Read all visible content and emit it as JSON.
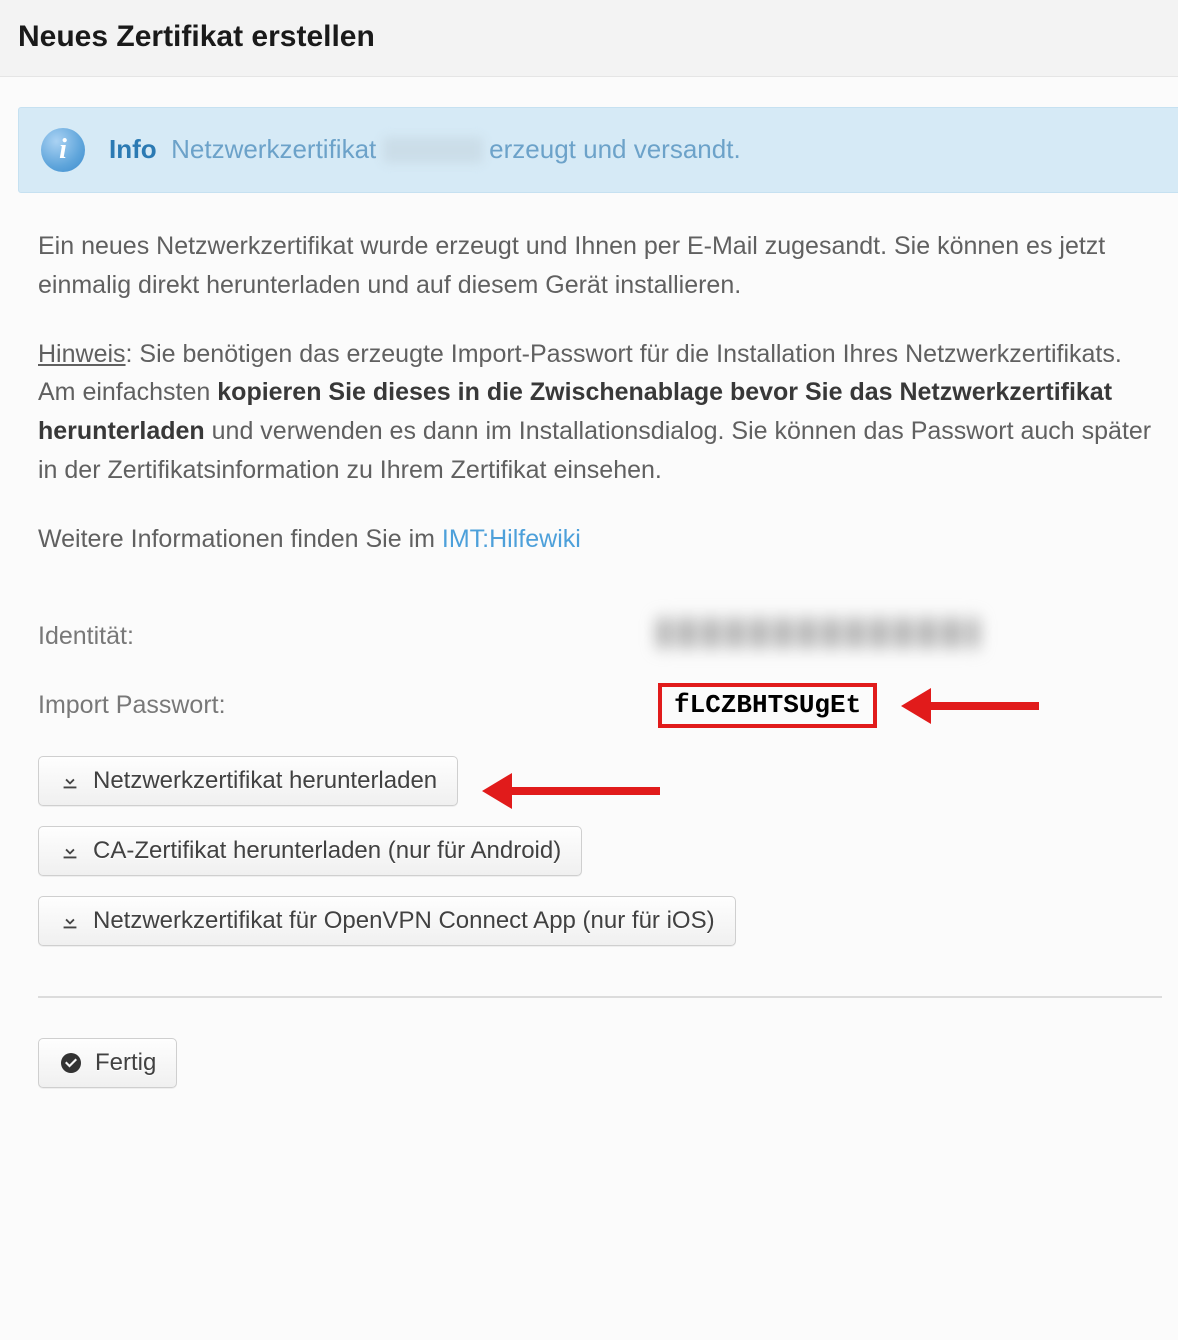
{
  "header": {
    "title": "Neues Zertifikat erstellen"
  },
  "info": {
    "label": "Info",
    "text_before": "Netzwerkzertifikat",
    "text_after": "erzeugt und versandt."
  },
  "paragraphs": {
    "p1": "Ein neues Netzwerkzertifikat wurde erzeugt und Ihnen per E-Mail zugesandt. Sie können es jetzt einmalig direkt herunterladen und auf diesem Gerät installieren.",
    "p2_label": "Hinweis",
    "p2_a": ": Sie benötigen das erzeugte Import-Passwort für die Installation Ihres Netzwerkzertifikats. Am einfachsten ",
    "p2_bold": "kopieren Sie dieses in die Zwischenablage bevor Sie das Netzwerkzertifikat herunterladen",
    "p2_b": " und verwenden es dann im Installationsdialog. Sie können das Passwort auch später in der Zertifikatsinformation zu Ihrem Zertifikat einsehen.",
    "p3_a": "Weitere Informationen finden Sie im ",
    "p3_link": "IMT:Hilfewiki"
  },
  "fields": {
    "identity_label": "Identität:",
    "password_label": "Import Passwort:",
    "password_value": "fLCZBHTSUgEt"
  },
  "buttons": {
    "download_cert": "Netzwerkzertifikat herunterladen",
    "download_ca": "CA-Zertifikat herunterladen (nur für Android)",
    "download_openvpn": "Netzwerkzertifikat für OpenVPN Connect App (nur für iOS)",
    "done": "Fertig"
  }
}
